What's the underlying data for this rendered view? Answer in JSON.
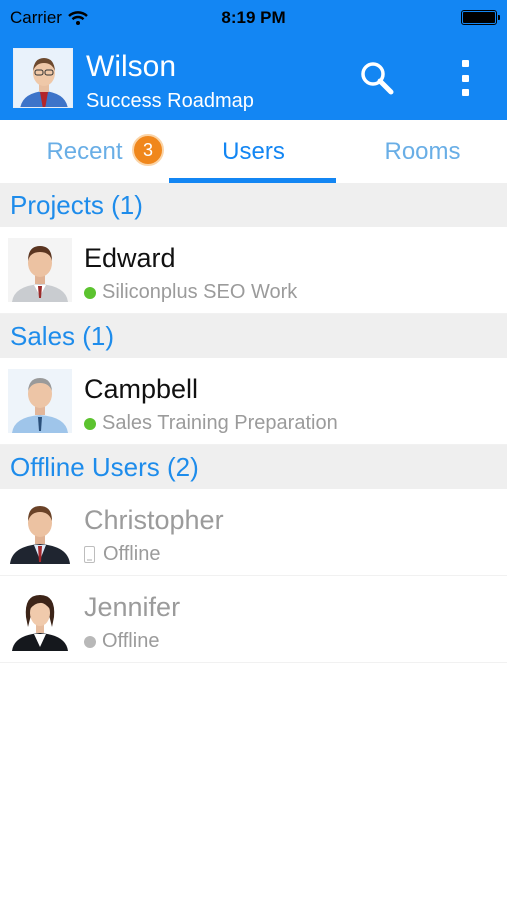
{
  "status_bar": {
    "carrier": "Carrier",
    "time": "8:19 PM"
  },
  "header": {
    "name": "Wilson",
    "subtitle": "Success Roadmap"
  },
  "tabs": [
    {
      "label": "Recent",
      "badge": "3"
    },
    {
      "label": "Users",
      "active": true
    },
    {
      "label": "Rooms"
    }
  ],
  "sections": [
    {
      "title": "Projects (1)",
      "users": [
        {
          "name": "Edward",
          "status": "Siliconplus SEO Work",
          "presence": "online"
        }
      ]
    },
    {
      "title": "Sales (1)",
      "users": [
        {
          "name": "Campbell",
          "status": "Sales Training Preparation",
          "presence": "online"
        }
      ]
    },
    {
      "title": "Offline Users (2)",
      "users": [
        {
          "name": "Christopher",
          "status": "Offline",
          "presence": "mobile-offline"
        },
        {
          "name": "Jennifer",
          "status": "Offline",
          "presence": "offline"
        }
      ]
    }
  ],
  "colors": {
    "primary": "#1386f3",
    "online": "#5cc32f",
    "badge": "#f0871c"
  },
  "icons": {
    "search": "search-icon",
    "more": "more-vertical-icon",
    "wifi": "wifi-icon",
    "battery": "battery-icon"
  }
}
